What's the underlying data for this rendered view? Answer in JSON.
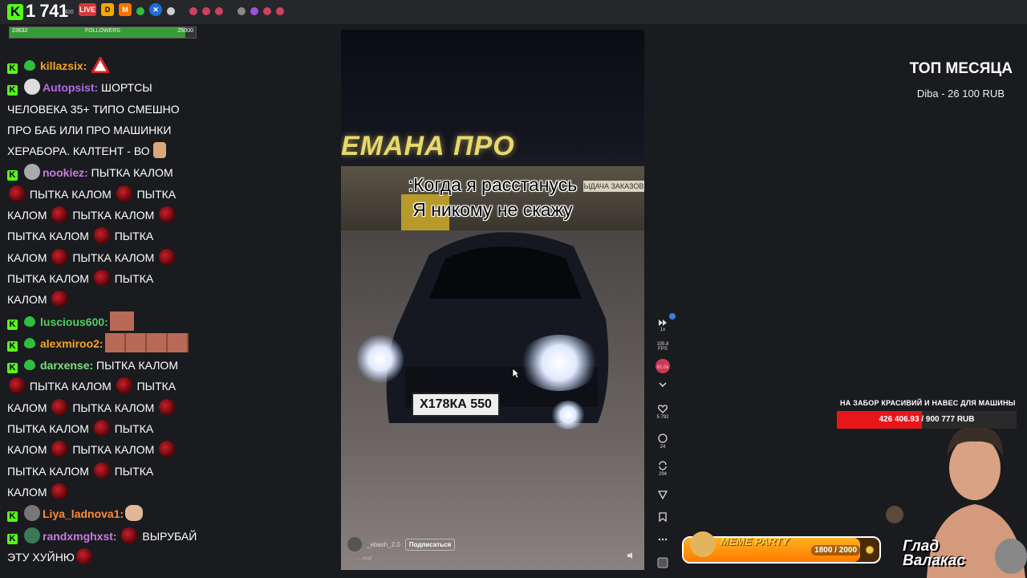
{
  "topbar": {
    "viewer_count": "1 741",
    "viewer_suffix": "400",
    "icons": [
      "kick-logo-icon",
      "live-icon",
      "donation-icon",
      "memealerts-icon",
      "x-icon"
    ],
    "followers_label": "FOLLOWERS",
    "followers_current": "23632",
    "followers_goal": "25000",
    "followers_fraction": 0.945
  },
  "chat": {
    "messages": [
      {
        "user": "killazsix:",
        "color": "#f5a524",
        "text": ""
      },
      {
        "user": "Autopsist:",
        "color": "#b06be6",
        "text": "ШОРТСЫ ЧЕЛОВЕКА 35+ ТИПО СМЕШНО ПРО БАБ ИЛИ ПРО МАШИНКИ ХЕРАБОРА. КАЛТЕНТ - ВО"
      },
      {
        "user": "nookiez:",
        "color": "#c77be0",
        "text_a": "ПЫТКА КАЛОМ",
        "text_b": "ПЫТКА КАЛОМ",
        "text_c": "ПЫТКА КАЛОМ",
        "text_d": "ПЫТКА КАЛОМ",
        "text_e": "ПЫТКА КАЛОМ",
        "text_f": "ПЫТКА КАЛОМ",
        "text_g": "ПЫТКА КАЛОМ",
        "text_h": "ПЫТКА КАЛОМ",
        "text_i": "ПЫТКА КАЛОМ"
      },
      {
        "user": "luscious600:",
        "color": "#4fd160",
        "text": ""
      },
      {
        "user": "alexmiroo2:",
        "color": "#f5a524",
        "text": ""
      },
      {
        "user": "darxense:",
        "color": "#7be07b",
        "text": "ПЫТКА КАЛОМ"
      },
      {
        "user": "Liya_ladnova1:",
        "color": "#ff8c3a",
        "text": ""
      },
      {
        "user": "randxmghxst:",
        "color": "#c77be0",
        "text": "ВЫРУБАЙ ЭТУ ХУЙНЮ"
      }
    ],
    "autopsist_lines": [
      "ШОРТСЫ",
      "ЧЕЛОВЕКА 35+ ТИПО СМЕШНО",
      "ПРО БАБ ИЛИ ПРО МАШИНКИ",
      "ХЕРАБОРА. КАЛТЕНТ - ВО"
    ],
    "spam_word": "ПЫТКА КАЛОМ",
    "spam_left": "ПЫТКА",
    "spam_right": "КАЛОМ",
    "rand_line1": "ВЫРУБАЙ",
    "rand_line2": "ЭТУ ХУЙНЮ"
  },
  "video": {
    "store_sign": "ЕМАНА ПРО",
    "store_sign_small": "ЫДАЧА ЗАКАЗОВ",
    "caption_line1": ":Когда я расстанусь",
    "caption_line2": "Я никому не скажу",
    "plate": "Х178КА 550",
    "author": "_ebash_2.0",
    "subscribe": "Подписаться",
    "author_sub": "... ещё"
  },
  "video_controls": {
    "speed": "1x",
    "fps_value": "105.8",
    "fps_unit": "FPS",
    "boost": "81.0к",
    "likes": "5 792",
    "comments": "24",
    "reposts": "294"
  },
  "right": {
    "top_title": "ТОП МЕСЯЦА",
    "top_entry": "Diba - 26 100 RUB",
    "goal_title": "НА ЗАБОР КРАСИВИЙ И НАВЕС ДЛЯ МАШИНЫ",
    "goal_current": "426 406.93",
    "goal_total": "900 777 RUB",
    "goal_fraction": 0.4734,
    "meme_title": "MEME PARTY",
    "meme_count": "1800 / 2000",
    "meme_fraction": 0.9,
    "streamer_name_1": "Глад",
    "streamer_name_2": "Валакас"
  },
  "colors": {
    "kick_green": "#53fc18",
    "goal_red": "#e8151b",
    "meme_orange": "#ff9a00"
  }
}
